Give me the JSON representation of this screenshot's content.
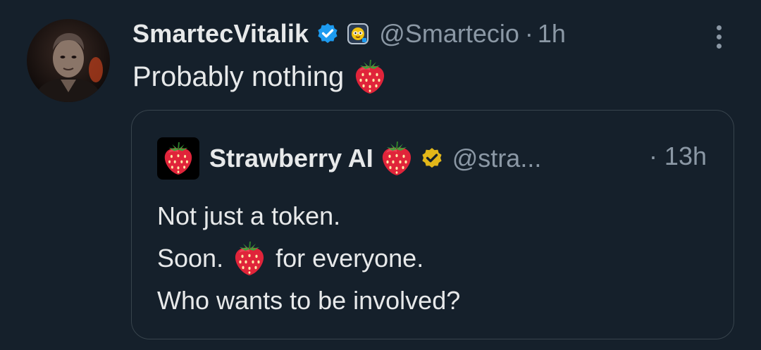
{
  "tweet": {
    "author_name": "SmartecVitalik",
    "author_handle": "@Smartecio",
    "separator": "·",
    "time": "1h",
    "text": "Probably nothing",
    "emoji": "strawberry",
    "icons": [
      "avatar",
      "verified-badge-icon",
      "affiliate-badge-icon",
      "more-options-icon"
    ]
  },
  "quoted_tweet": {
    "author_name": "Strawberry AI",
    "author_handle": "@stra...",
    "time": "· 13h",
    "lines": [
      {
        "before": "Not just a token.",
        "after": ""
      },
      {
        "before": "Soon.",
        "after": "for everyone."
      },
      {
        "before": "Who wants to be involved?",
        "after": ""
      }
    ],
    "emoji": "strawberry",
    "badge": "gold-verified-badge-icon"
  },
  "colors": {
    "background": "#15202b",
    "text": "#e7e9ea",
    "muted": "#8b98a5",
    "border": "#38444d",
    "verified_blue": "#1d9bf0",
    "gold": "#e2b719",
    "strawberry": "#e0243a"
  }
}
